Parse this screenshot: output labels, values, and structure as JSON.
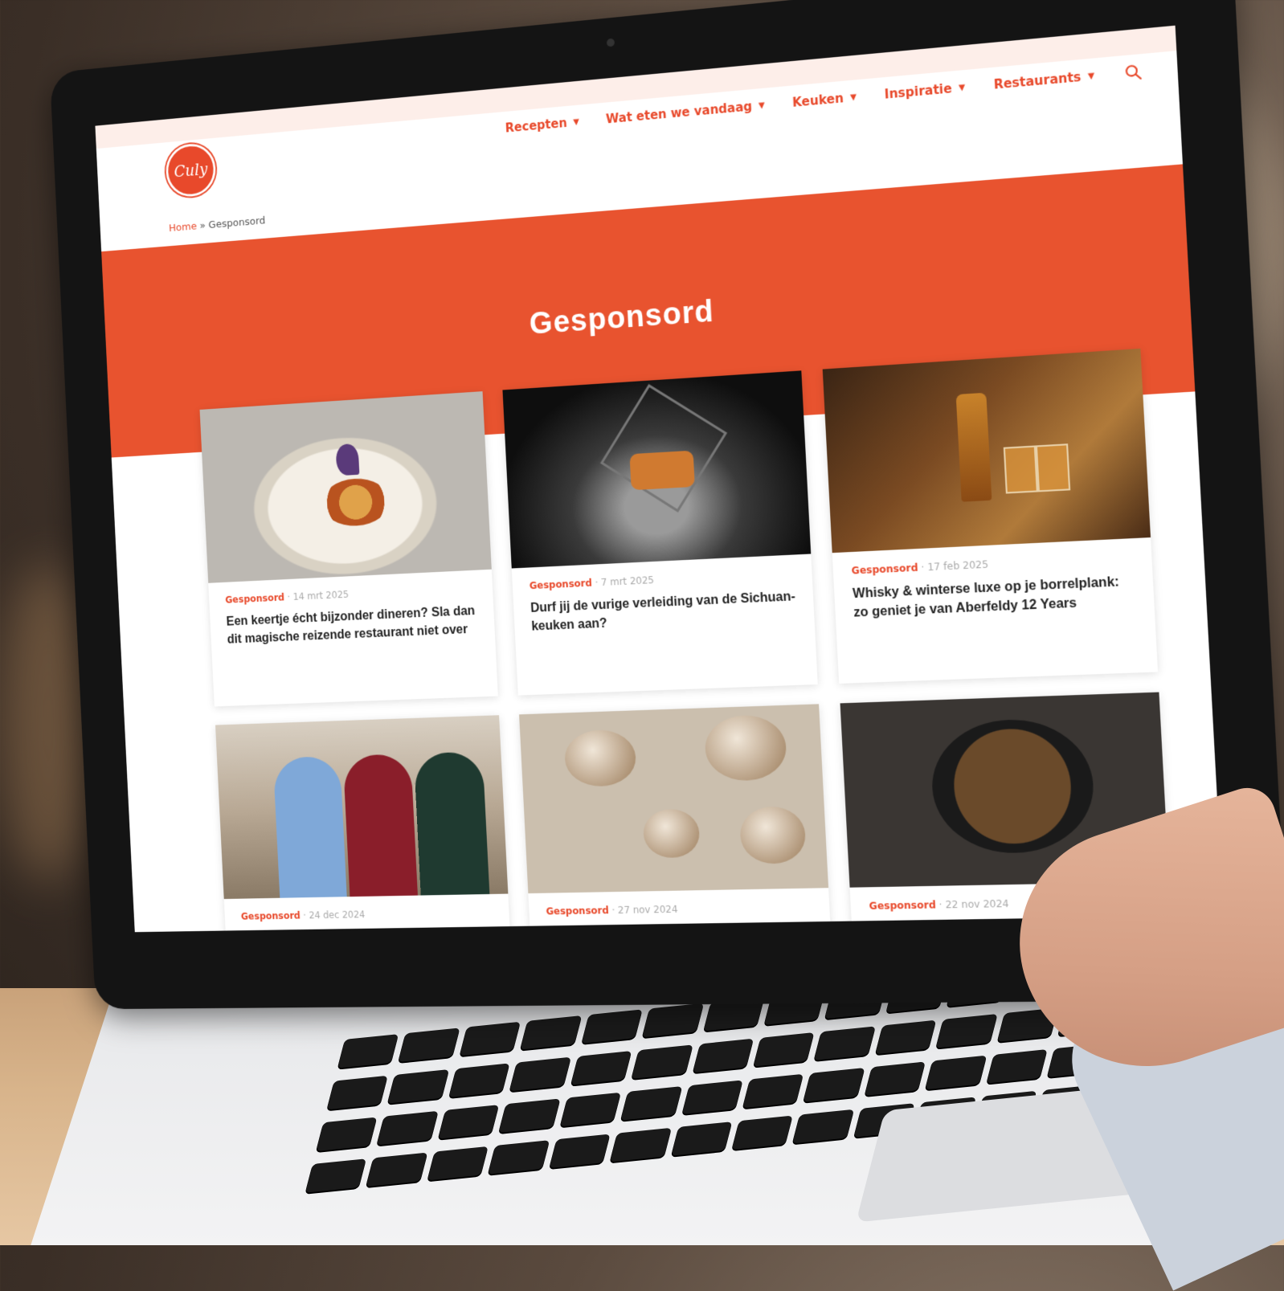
{
  "site": {
    "logo_text": "Culy",
    "nav": [
      {
        "label": "Recepten"
      },
      {
        "label": "Wat eten we vandaag"
      },
      {
        "label": "Keuken"
      },
      {
        "label": "Inspiratie"
      },
      {
        "label": "Restaurants"
      }
    ],
    "breadcrumb": {
      "home": "Home",
      "separator": " » ",
      "current": "Gesponsord"
    },
    "hero_title": "Gesponsord",
    "accent_color": "#e8492b"
  },
  "articles": [
    {
      "tag": "Gesponsord",
      "date": "14 mrt 2025",
      "title": "Een keertje écht bijzonder dineren? Sla dan dit magische reizende restaurant niet over"
    },
    {
      "tag": "Gesponsord",
      "date": "7 mrt 2025",
      "title": "Durf jij de vurige verleiding van de Sichuan-keuken aan?"
    },
    {
      "tag": "Gesponsord",
      "date": "17 feb 2025",
      "title": "Whisky & winterse luxe op je borrelplank: zo geniet je van Aberfeldy 12 Years"
    },
    {
      "tag": "Gesponsord",
      "date": "24 dec 2024",
      "title": ""
    },
    {
      "tag": "Gesponsord",
      "date": "27 nov 2024",
      "title": ""
    },
    {
      "tag": "Gesponsord",
      "date": "22 nov 2024",
      "title": ""
    }
  ]
}
